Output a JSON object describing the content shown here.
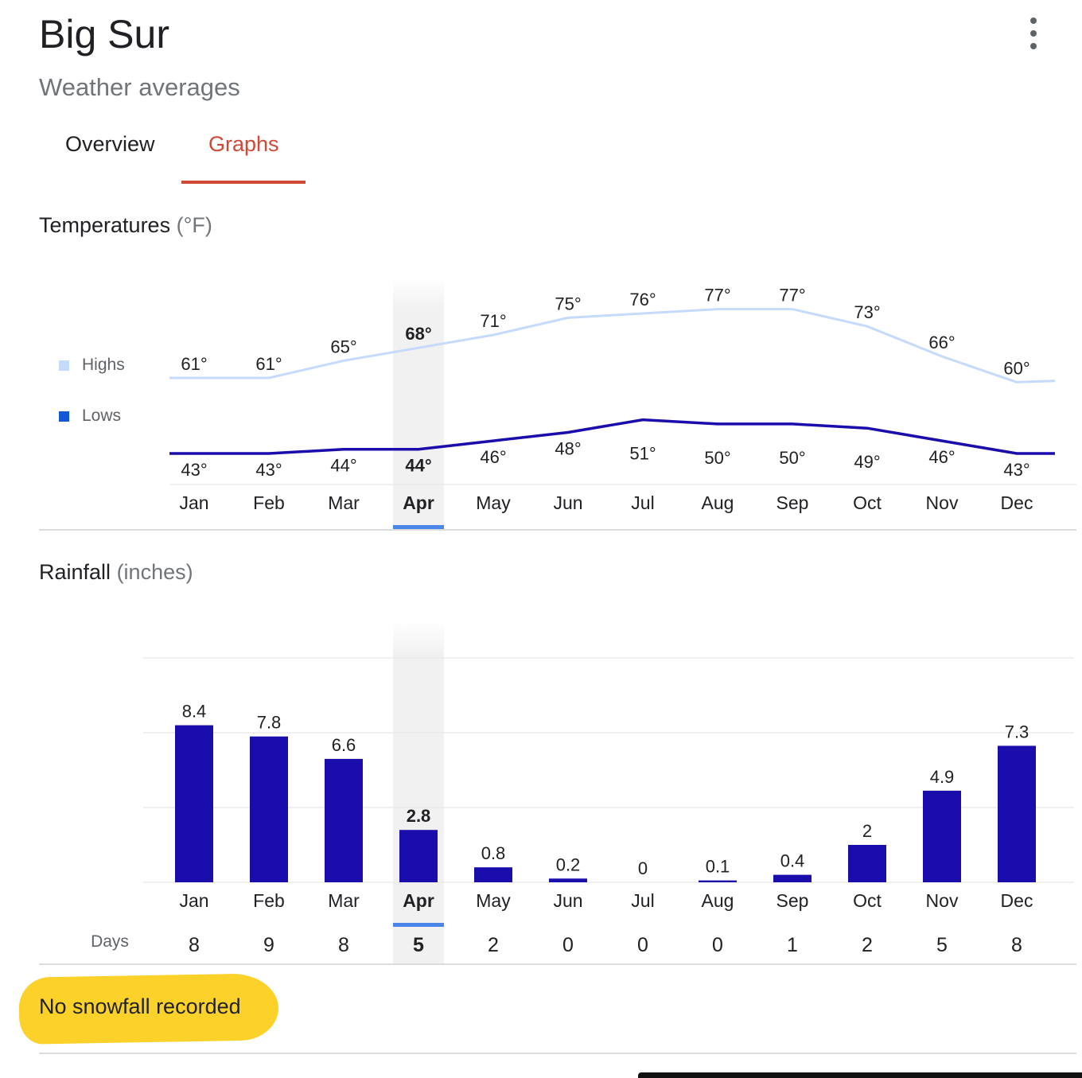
{
  "header": {
    "title": "Big Sur",
    "subtitle": "Weather averages",
    "menu_icon": "more-vert-icon"
  },
  "tabs": [
    {
      "label": "Overview",
      "active": false
    },
    {
      "label": "Graphs",
      "active": true
    }
  ],
  "colors": {
    "accent": "#d14836",
    "highs": "#c6dafc",
    "lows": "#1a0dab",
    "highs_legend": "#c6dafc",
    "lows_legend": "#1558d6",
    "bars": "#1a0dab",
    "selected_marker": "#4a86e8",
    "selected_column": "#f1f1f1",
    "highlight": "#fcd12a"
  },
  "temperature": {
    "title": "Temperatures",
    "unit": "(°F)",
    "legend": [
      {
        "label": "Highs",
        "color": "#c6dafc"
      },
      {
        "label": "Lows",
        "color": "#1558d6"
      }
    ]
  },
  "rainfall": {
    "title": "Rainfall",
    "unit": "(inches)",
    "days_label": "Days"
  },
  "selected_month": "Apr",
  "chart_data": [
    {
      "type": "line",
      "categories": [
        "Jan",
        "Feb",
        "Mar",
        "Apr",
        "May",
        "Jun",
        "Jul",
        "Aug",
        "Sep",
        "Oct",
        "Nov",
        "Dec"
      ],
      "series": [
        {
          "name": "Highs",
          "values": [
            61,
            61,
            65,
            68,
            71,
            75,
            76,
            77,
            77,
            73,
            66,
            60
          ],
          "labels": [
            "61°",
            "61°",
            "65°",
            "68°",
            "71°",
            "75°",
            "76°",
            "77°",
            "77°",
            "73°",
            "66°",
            "60°"
          ]
        },
        {
          "name": "Lows",
          "values": [
            43,
            43,
            44,
            44,
            46,
            48,
            51,
            50,
            50,
            49,
            46,
            43
          ],
          "labels": [
            "43°",
            "43°",
            "44°",
            "44°",
            "46°",
            "48°",
            "51°",
            "50°",
            "50°",
            "49°",
            "46°",
            "43°"
          ]
        }
      ],
      "highlight_category": "Apr"
    },
    {
      "type": "bar",
      "categories": [
        "Jan",
        "Feb",
        "Mar",
        "Apr",
        "May",
        "Jun",
        "Jul",
        "Aug",
        "Sep",
        "Oct",
        "Nov",
        "Dec"
      ],
      "values": [
        8.4,
        7.8,
        6.6,
        2.8,
        0.8,
        0.2,
        0,
        0.1,
        0.4,
        2,
        4.9,
        7.3
      ],
      "value_labels": [
        "8.4",
        "7.8",
        "6.6",
        "2.8",
        "0.8",
        "0.2",
        "0",
        "0.1",
        "0.4",
        "2",
        "4.9",
        "7.3"
      ],
      "days": [
        "8",
        "9",
        "8",
        "5",
        "2",
        "0",
        "0",
        "0",
        "1",
        "2",
        "5",
        "8"
      ],
      "grid": true,
      "highlight_category": "Apr"
    }
  ],
  "snowfall": {
    "text": "No snowfall recorded"
  }
}
